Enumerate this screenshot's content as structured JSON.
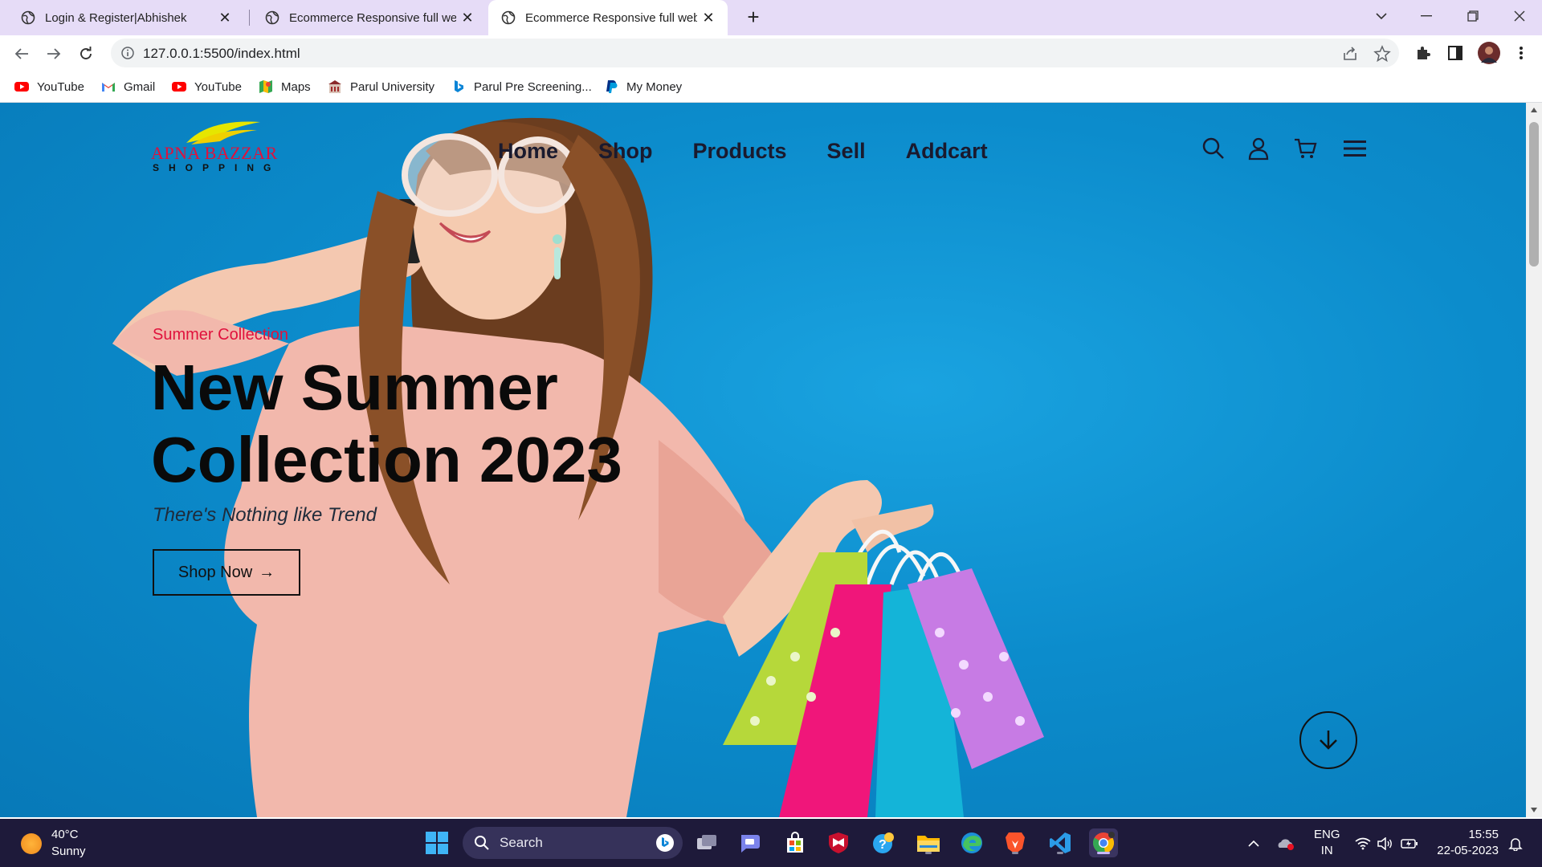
{
  "browser": {
    "tabs": [
      {
        "title": "Login & Register|Abhishek",
        "active": false
      },
      {
        "title": "Ecommerce Responsive full webs",
        "active": false
      },
      {
        "title": "Ecommerce Responsive full webs",
        "active": true
      }
    ],
    "url": "127.0.0.1:5500/index.html",
    "bookmarks": [
      {
        "label": "YouTube",
        "icon": "youtube-icon"
      },
      {
        "label": "Gmail",
        "icon": "gmail-icon"
      },
      {
        "label": "YouTube",
        "icon": "youtube-icon"
      },
      {
        "label": "Maps",
        "icon": "maps-icon"
      },
      {
        "label": "Parul University",
        "icon": "parul-university-icon"
      },
      {
        "label": "Parul Pre Screening...",
        "icon": "bing-icon"
      },
      {
        "label": "My Money",
        "icon": "paypal-icon"
      }
    ]
  },
  "site": {
    "logo": {
      "title": "APNA BAZZAR",
      "subtitle": "SHOPPING"
    },
    "nav": [
      "Home",
      "Shop",
      "Products",
      "Sell",
      "Addcart"
    ],
    "nav_icons": [
      "search-icon",
      "user-icon",
      "cart-icon",
      "menu-icon"
    ],
    "hero": {
      "eyebrow": "Summer Collection",
      "headline_line1": "New Summer",
      "headline_line2": "Collection 2023",
      "tagline": "There's Nothing like Trend",
      "cta": "Shop Now",
      "cta_arrow": "→"
    },
    "colors": {
      "accent": "#e0113c",
      "hero_bg": "#0c8ccc",
      "text": "#0a0a0a"
    }
  },
  "taskbar": {
    "weather": {
      "temp": "40°C",
      "condition": "Sunny"
    },
    "search_label": "Search",
    "language": {
      "line1": "ENG",
      "line2": "IN"
    },
    "clock": {
      "time": "15:55",
      "date": "22-05-2023"
    }
  }
}
